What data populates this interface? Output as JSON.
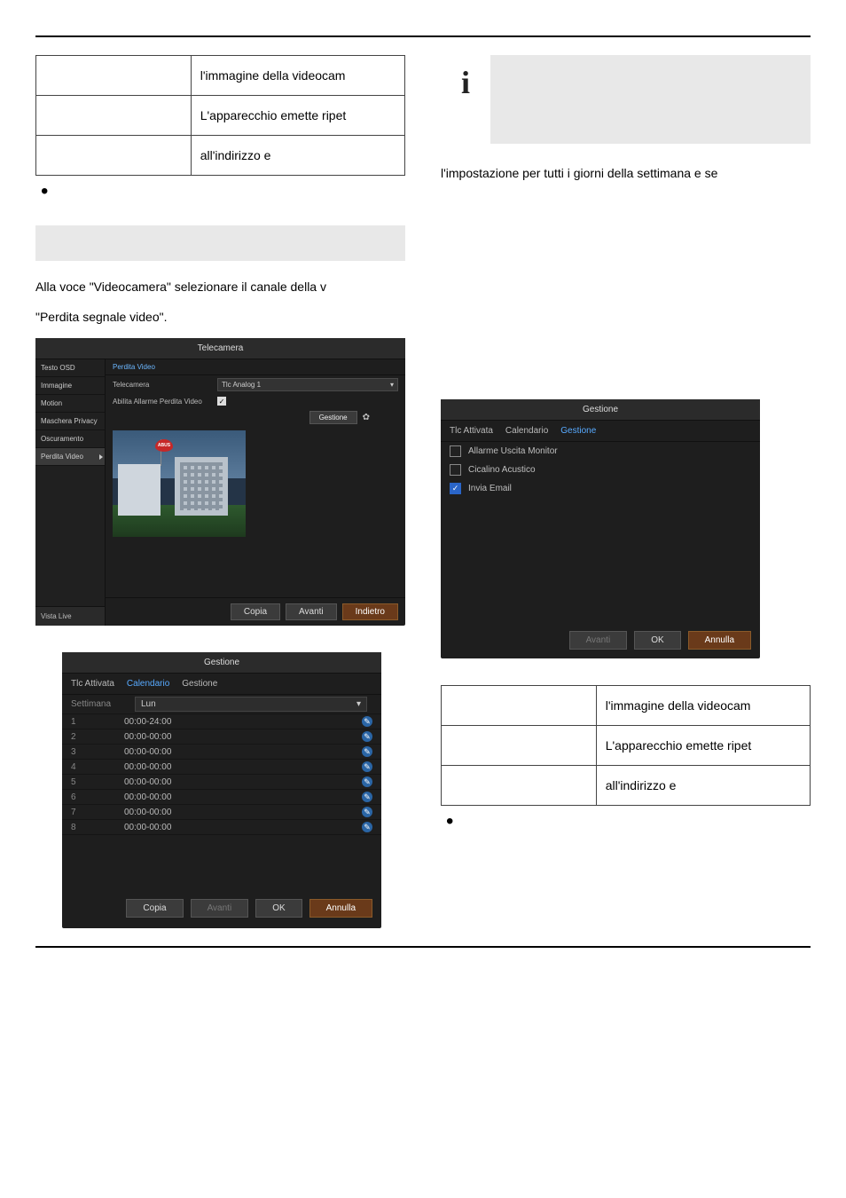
{
  "table1": {
    "rows": [
      {
        "left": "",
        "right": "l'immagine della videocam"
      },
      {
        "left": "",
        "right": "L'apparecchio emette ripet"
      },
      {
        "left": "",
        "right": "all'indirizzo e"
      }
    ]
  },
  "left_text": {
    "p1": "Alla voce \"Videocamera\" selezionare il canale della v",
    "p2": "\"Perdita segnale video\"."
  },
  "right_text": {
    "info_body": "",
    "under_info": "l'impostazione per tutti i giorni della settimana e se"
  },
  "cam_panel": {
    "title": "Telecamera",
    "side_items": [
      "Testo OSD",
      "Immagine",
      "Motion",
      "Maschera Privacy",
      "Oscuramento",
      "Perdita Video"
    ],
    "side_bottom": "Vista Live",
    "tab": "Perdita Video",
    "form": {
      "camera_label": "Telecamera",
      "camera_value": "Tlc Analog 1",
      "enable_label": "Abilita Allarme Perdita Video",
      "manage_btn": "Gestione"
    },
    "flag_text": "ABUS",
    "btns": {
      "copia": "Copia",
      "avanti": "Avanti",
      "indietro": "Indietro"
    }
  },
  "sched_dialog": {
    "title": "Gestione",
    "tabs": {
      "t1": "Tlc Attivata",
      "t2": "Calendario",
      "t3": "Gestione"
    },
    "week_label": "Settimana",
    "week_value": "Lun",
    "rows": [
      {
        "idx": "1",
        "time": "00:00-24:00"
      },
      {
        "idx": "2",
        "time": "00:00-00:00"
      },
      {
        "idx": "3",
        "time": "00:00-00:00"
      },
      {
        "idx": "4",
        "time": "00:00-00:00"
      },
      {
        "idx": "5",
        "time": "00:00-00:00"
      },
      {
        "idx": "6",
        "time": "00:00-00:00"
      },
      {
        "idx": "7",
        "time": "00:00-00:00"
      },
      {
        "idx": "8",
        "time": "00:00-00:00"
      }
    ],
    "btns": {
      "copia": "Copia",
      "avanti": "Avanti",
      "ok": "OK",
      "annulla": "Annulla"
    }
  },
  "react_dialog": {
    "title": "Gestione",
    "tabs": {
      "t1": "Tlc Attivata",
      "t2": "Calendario",
      "t3": "Gestione"
    },
    "opts": [
      {
        "label": "Allarme Uscita Monitor",
        "on": false
      },
      {
        "label": "Cicalino Acustico",
        "on": false
      },
      {
        "label": "Invia Email",
        "on": true
      }
    ],
    "btns": {
      "avanti": "Avanti",
      "ok": "OK",
      "annulla": "Annulla"
    }
  },
  "table2": {
    "rows": [
      {
        "left": "",
        "right": "l'immagine della videocam"
      },
      {
        "left": "",
        "right": "L'apparecchio emette ripet"
      },
      {
        "left": "",
        "right": "all'indirizzo e"
      }
    ]
  },
  "icons": {
    "info": "i",
    "check": "✓",
    "gear": "✿",
    "chev": "▾",
    "edit": "✎"
  }
}
